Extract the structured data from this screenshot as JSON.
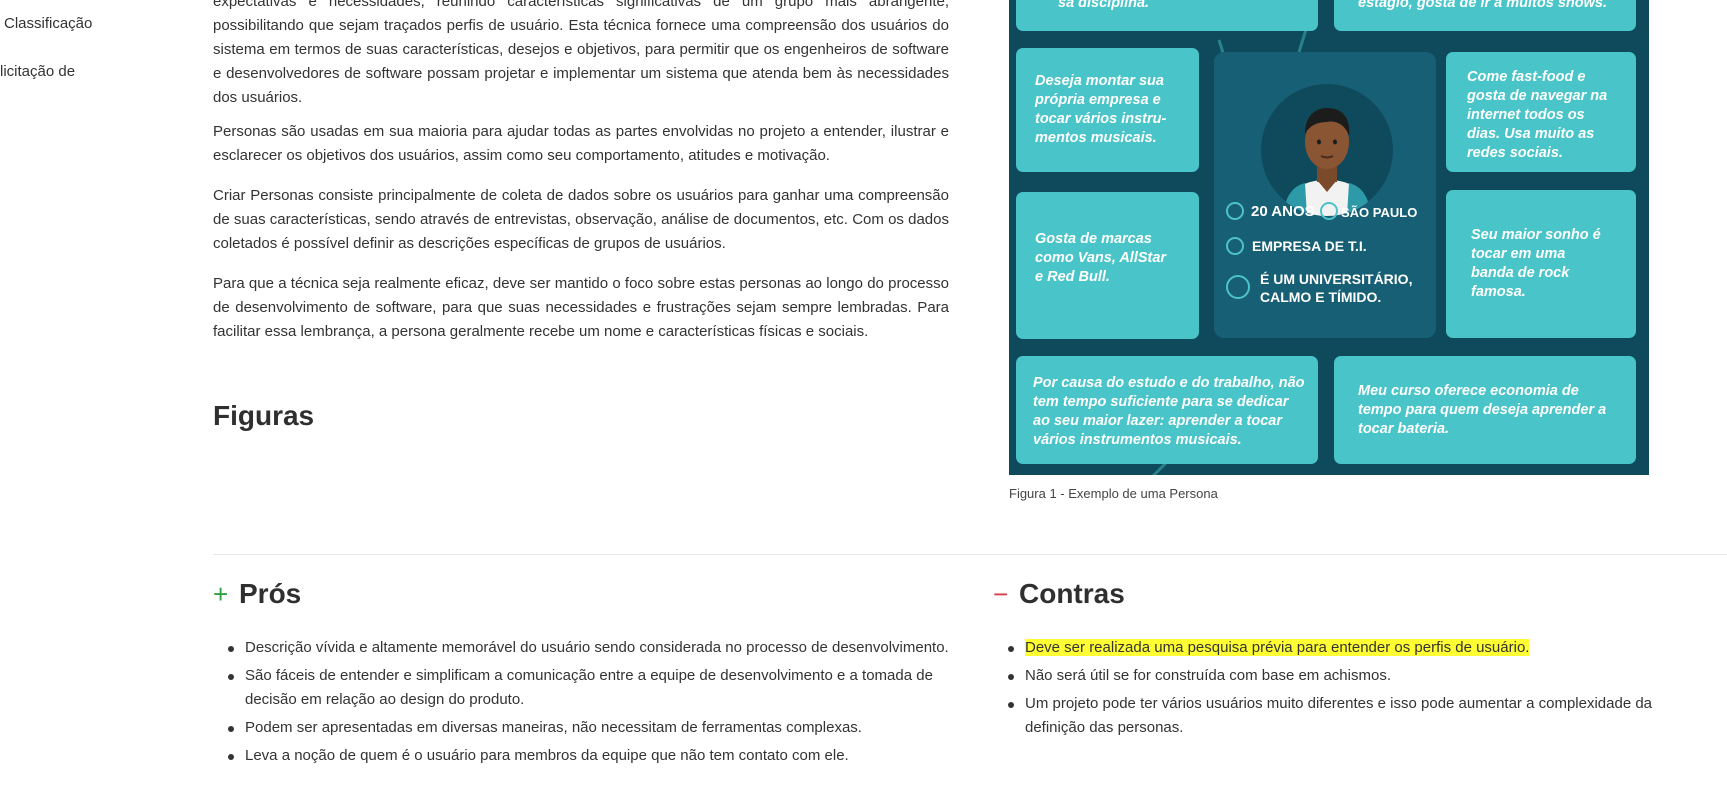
{
  "toc": {
    "items": [
      "Classificação",
      "licitação de"
    ]
  },
  "article": {
    "paragraphs": [
      "expectativas e necessidades, reunindo características significativas de um grupo mais abrangente, possibilitando que sejam traçados perfis de usuário. Esta técnica fornece uma compreensão dos usuários do sistema em termos de suas características, desejos e objetivos, para permitir que os engenheiros de software e desenvolvedores de software possam projetar e implementar um sistema que atenda bem às necessidades dos usuários.",
      "Personas são usadas em sua maioria para ajudar todas as partes envolvidas no projeto a entender, ilustrar e esclarecer os objetivos dos usuários, assim como seu comportamento, atitudes e motivação.",
      "Criar Personas consiste principalmente de coleta de dados sobre os usuários para ganhar uma compreensão de suas características, sendo através de entrevistas, observação, análise de documentos, etc. Com os dados coletados é possível definir as descrições específicas de grupos de usuários.",
      "Para que a técnica seja realmente eficaz, deve ser mantido o foco sobre estas personas ao longo do processo de desenvolvimento de software, para que suas necessidades e frustrações sejam sempre lembradas. Para facilitar essa lembrança, a persona geralmente recebe um nome e características físicas e sociais."
    ],
    "figures_heading": "Figuras"
  },
  "figure": {
    "cards": {
      "top_left": "sa disciplina.",
      "top_right": "estágio, gosta de ir a muitos shows.",
      "mid_left_1": [
        "Deseja montar sua",
        "própria empresa e",
        "tocar vários instru-",
        "mentos musicais."
      ],
      "mid_left_2": [
        "Gosta de marcas",
        "como Vans, AllStar",
        "e Red Bull."
      ],
      "mid_right_1": [
        "Come fast-food e",
        "gosta de navegar na",
        "internet todos os",
        "dias. Usa muito as",
        "redes sociais."
      ],
      "mid_right_2": [
        "Seu maior sonho é",
        "tocar em uma",
        "banda de rock",
        "famosa."
      ],
      "bottom_left": [
        "Por causa do estudo e do trabalho, não",
        "tem tempo suficiente para se dedicar",
        "ao seu maior lazer: aprender a tocar",
        "vários instrumentos musicais."
      ],
      "bottom_right": [
        "Meu curso oferece economia de",
        "tempo para quem deseja aprender a",
        "tocar bateria."
      ]
    },
    "facts": {
      "age": "20 ANOS",
      "city": "SÃO PAULO",
      "company": "EMPRESA DE T.I.",
      "personality_1": "É UM UNIVERSITÁRIO,",
      "personality_2": "CALMO E TÍMIDO."
    },
    "caption": "Figura 1 - Exemplo de uma Persona",
    "colors": {
      "background": "#0e4a5c",
      "card": "#49c4c8",
      "center": "#175f74"
    }
  },
  "pros": {
    "sign": "+",
    "title": "Prós",
    "color": "#2ea043",
    "items": [
      "Descrição vívida e altamente memorável do usuário sendo considerada no processo de desenvolvimento.",
      "São fáceis de entender e simplificam a comunicação entre a equipe de desenvolvimento e a tomada de decisão em relação ao design do produto.",
      "Podem ser apresentadas em diversas maneiras, não necessitam de ferramentas complexas.",
      "Leva a noção de quem é o usuário para membros da equipe que não tem contato com ele."
    ]
  },
  "cons": {
    "sign": "−",
    "title": "Contras",
    "color": "#d73a49",
    "highlight_color": "#ffff33",
    "items": [
      "Deve ser realizada uma pesquisa prévia para entender os perfis de usuário.",
      "Não será útil se for construída com base em achismos.",
      "Um projeto pode ter vários usuários muito diferentes e isso pode aumentar a complexidade da definição das personas."
    ]
  }
}
